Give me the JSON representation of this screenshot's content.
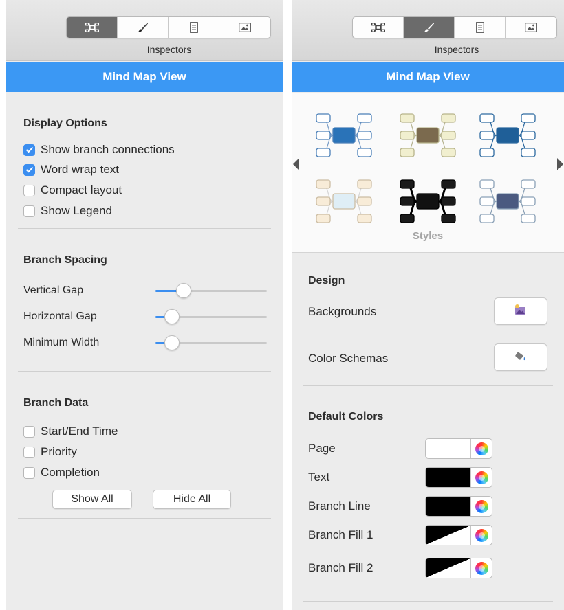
{
  "colors": {
    "accent": "#3b98f4",
    "checkbox_on": "#3b8ef0",
    "panel_bg": "#ececec"
  },
  "toolbar": {
    "label": "Inspectors",
    "tabs": [
      {
        "icon": "mindmap-icon"
      },
      {
        "icon": "brush-icon"
      },
      {
        "icon": "document-icon"
      },
      {
        "icon": "image-icon"
      }
    ]
  },
  "left": {
    "toolbar_active_tab": 0,
    "title": "Mind Map View",
    "display_options": {
      "title": "Display Options",
      "items": [
        {
          "label": "Show branch connections",
          "checked": true
        },
        {
          "label": "Word wrap text",
          "checked": true
        },
        {
          "label": "Compact layout",
          "checked": false
        },
        {
          "label": "Show Legend",
          "checked": false
        }
      ]
    },
    "branch_spacing": {
      "title": "Branch Spacing",
      "sliders": [
        {
          "label": "Vertical Gap",
          "level": 0.25
        },
        {
          "label": "Horizontal Gap",
          "level": 0.15
        },
        {
          "label": "Minimum Width",
          "level": 0.15
        }
      ]
    },
    "branch_data": {
      "title": "Branch Data",
      "items": [
        {
          "label": "Start/End Time",
          "checked": false
        },
        {
          "label": "Priority",
          "checked": false
        },
        {
          "label": "Completion",
          "checked": false
        }
      ],
      "show_all": "Show All",
      "hide_all": "Hide All"
    }
  },
  "right": {
    "toolbar_active_tab": 1,
    "title": "Mind Map View",
    "styles_label": "Styles",
    "styles": [
      {
        "name": "blue-style",
        "node": "#ffffff",
        "stroke": "#4a7fb8",
        "center": "#2a73b8",
        "line": "#7b9fc9"
      },
      {
        "name": "beige-style",
        "node": "#f1efcf",
        "stroke": "#b7b38a",
        "center": "#7b6a4e",
        "line": "#b8b694"
      },
      {
        "name": "outline-blue-style",
        "node": "#ffffff",
        "stroke": "#2d6aa0",
        "center": "#1f5f98",
        "line": "#2d6aa0"
      },
      {
        "name": "pastel-style",
        "node": "#f8ecd8",
        "stroke": "#ccbda3",
        "center": "#dfeef6",
        "line": "#d6d6d6"
      },
      {
        "name": "black-style",
        "node": "#1a1a1a",
        "stroke": "#000000",
        "center": "#111111",
        "line": "#000000"
      },
      {
        "name": "slate-style",
        "node": "#ffffff",
        "stroke": "#8aa0b6",
        "center": "#4b5a80",
        "line": "#8aa0b6"
      }
    ],
    "design": {
      "title": "Design",
      "backgrounds": "Backgrounds",
      "color_schemas": "Color Schemas"
    },
    "default_colors": {
      "title": "Default Colors",
      "items": [
        {
          "label": "Page",
          "swatch": "#ffffff",
          "split": false
        },
        {
          "label": "Text",
          "swatch": "#000000",
          "split": false
        },
        {
          "label": "Branch Line",
          "swatch": "#000000",
          "split": false
        },
        {
          "label": "Branch Fill 1",
          "swatch": "#000000",
          "split": true
        },
        {
          "label": "Branch Fill 2",
          "swatch": "#000000",
          "split": true
        }
      ]
    }
  }
}
